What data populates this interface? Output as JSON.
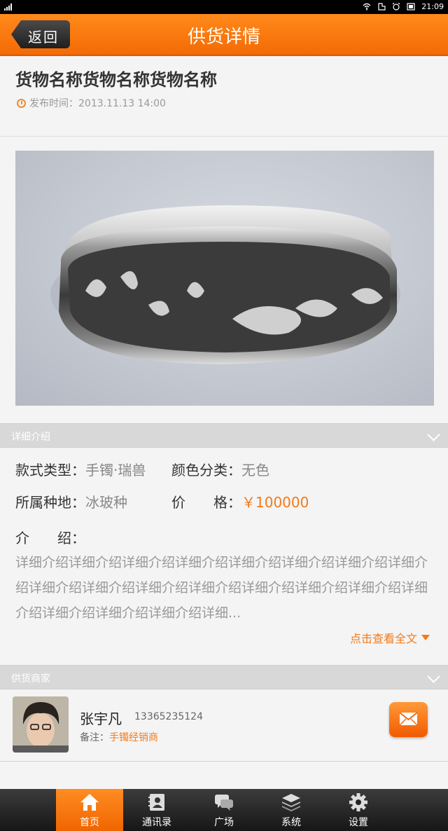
{
  "status_bar": {
    "time": "21:09"
  },
  "header": {
    "back_label": "返回",
    "title": "供货详情"
  },
  "goods": {
    "title": "货物名称货物名称货物名称",
    "publish_time": "发布时间：2013.11.13 14:00"
  },
  "detail_section": {
    "label": "详细介绍",
    "style_label": "款式类型：",
    "style_value": "手镯·瑞兽",
    "color_label": "颜色分类：",
    "color_value": "无色",
    "origin_label": "所属种地：",
    "origin_value": "冰玻种",
    "price_label": "价　　格：",
    "price_value": "￥100000",
    "intro_label": "介　　绍：",
    "intro_text": "详细介绍详细介绍详细介绍详细介绍详细介绍详细介绍详细介绍详细介绍详细介绍详细介绍详细介绍详细介绍详细介绍详细介绍详细介绍详细介绍详细介绍详细介绍详细介绍详细...",
    "view_all": "点击查看全文"
  },
  "supplier_section": {
    "label": "供货商家",
    "name": "张宇凡",
    "phone": "13365235124",
    "note_label": "备注：",
    "note_value": "手镯经销商"
  },
  "tabbar": {
    "items": [
      {
        "label": "首页",
        "icon": "home-icon",
        "active": true
      },
      {
        "label": "通讯录",
        "icon": "contacts-icon",
        "active": false
      },
      {
        "label": "广场",
        "icon": "chat-icon",
        "active": false
      },
      {
        "label": "系统",
        "icon": "layers-icon",
        "active": false
      },
      {
        "label": "设置",
        "icon": "gear-icon",
        "active": false
      }
    ]
  },
  "colors": {
    "accent": "#f47a18",
    "header": "#ff7f12",
    "tabbar": "#2a2a2a"
  }
}
